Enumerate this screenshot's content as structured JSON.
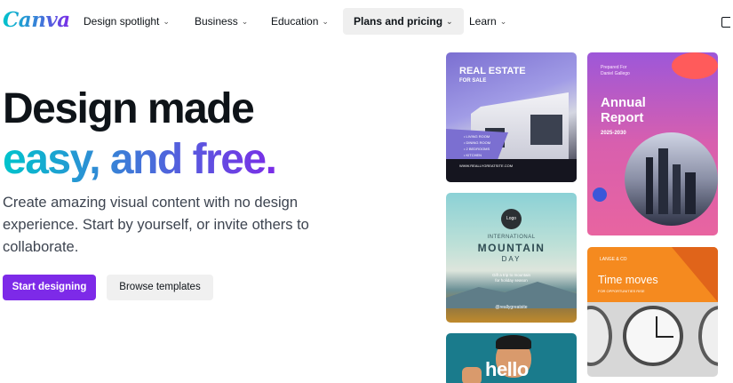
{
  "nav": {
    "logo": "Canva",
    "items": [
      {
        "label": "Design spotlight"
      },
      {
        "label": "Business"
      },
      {
        "label": "Education"
      },
      {
        "label": "Plans and pricing"
      },
      {
        "label": "Learn"
      }
    ],
    "active_item": "Plans and pricing"
  },
  "hero": {
    "line1": "Design made",
    "line2": "easy, and free.",
    "subtitle": "Create amazing visual content with no design experience. Start by yourself, or invite others to collaborate.",
    "primary_button": "Start designing",
    "secondary_button": "Browse templates"
  },
  "templates": {
    "real_estate": {
      "title": "REAL ESTATE",
      "subtitle": "FOR SALE",
      "bullets": [
        "• LIVING ROOM",
        "• DINING ROOM",
        "• 2 BEDROOMS",
        "• KITCHEN"
      ],
      "footer": "WWW.REALLYGREATSITE.COM"
    },
    "annual_report": {
      "small1": "Prepared For",
      "small2": "Daniel Gallego",
      "title_line1": "Annual",
      "title_line2": "Report",
      "years": "2025-2030"
    },
    "mountain": {
      "logo": "Logo",
      "line1": "INTERNATIONAL",
      "line2": "MOUNTAIN",
      "line3": "DAY",
      "gift_line1": "Gift a trip to mountain",
      "gift_line2": "for holiday season",
      "handle": "@reallygreatsite"
    },
    "time_moves": {
      "brand": "LANGE & CO",
      "title": "Time moves",
      "subtitle": "FOR OPPORTUNITIES RISE"
    },
    "hello": {
      "word": "hello"
    }
  },
  "colors": {
    "brand_purple": "#7d2ae8",
    "brand_teal": "#00c4cc",
    "text_dark": "#0e1318"
  }
}
